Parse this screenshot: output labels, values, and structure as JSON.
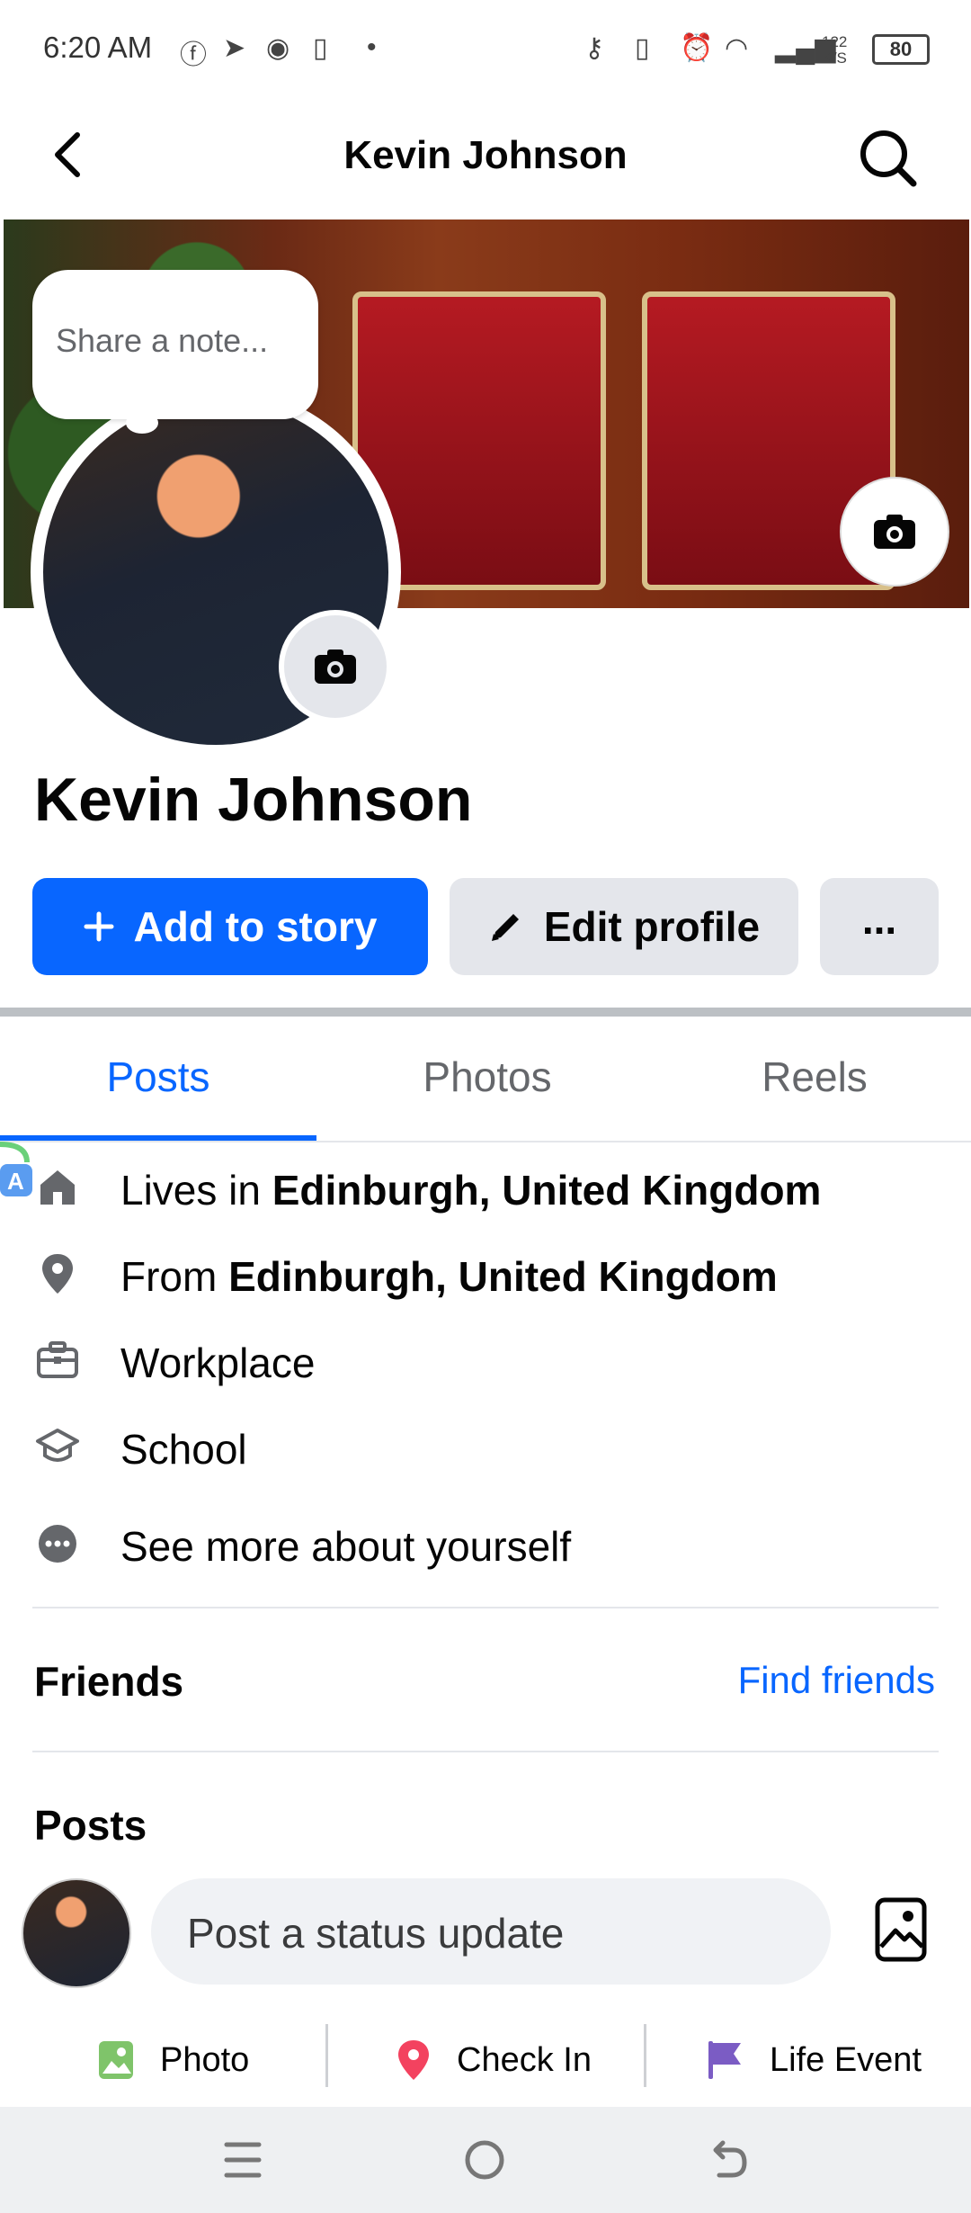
{
  "status_bar": {
    "time": "6:20 AM",
    "net_speed_value": "122",
    "net_speed_unit": "K/S",
    "battery": "80"
  },
  "header": {
    "title": "Kevin Johnson"
  },
  "profile": {
    "note_placeholder": "Share a note...",
    "name": "Kevin Johnson"
  },
  "actions": {
    "add_story": "Add to story",
    "edit_profile": "Edit profile",
    "more": "..."
  },
  "tabs": [
    {
      "label": "Posts",
      "active": true
    },
    {
      "label": "Photos",
      "active": false
    },
    {
      "label": "Reels",
      "active": false
    }
  ],
  "details": {
    "lives_prefix": "Lives in ",
    "lives_place": "Edinburgh, United Kingdom",
    "from_prefix": "From ",
    "from_place": "Edinburgh, United Kingdom",
    "workplace": "Workplace",
    "school": "School",
    "see_more": "See more about yourself"
  },
  "friends": {
    "title": "Friends",
    "find_link": "Find friends"
  },
  "posts": {
    "title": "Posts",
    "status_placeholder": "Post a status update",
    "photo_label": "Photo",
    "checkin_label": "Check In",
    "life_event_label": "Life Event"
  },
  "colors": {
    "brand_blue": "#0866ff",
    "button_grey": "#e4e6eb"
  }
}
